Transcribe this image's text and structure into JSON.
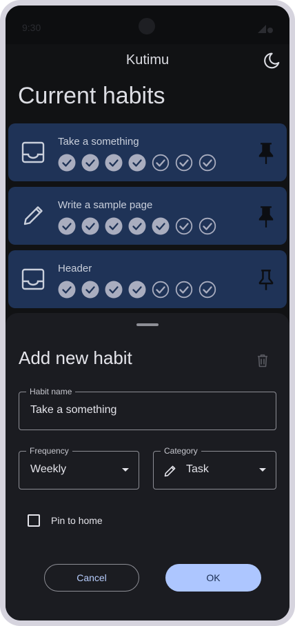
{
  "status_bar": {
    "time": "9:30"
  },
  "app_bar": {
    "title": "Kutimu",
    "theme_icon": "moon-icon"
  },
  "heading": "Current habits",
  "habits": [
    {
      "name": "Take a something",
      "icon": "inbox-tray-icon",
      "completed": [
        true,
        true,
        true,
        true,
        false,
        false,
        false
      ],
      "pinned": true
    },
    {
      "name": "Write a sample page",
      "icon": "pencil-icon",
      "completed": [
        true,
        true,
        true,
        true,
        true,
        false,
        false
      ],
      "pinned": true
    },
    {
      "name": "Header",
      "icon": "inbox-tray-icon",
      "completed": [
        true,
        true,
        true,
        true,
        false,
        false,
        false
      ],
      "pinned": false
    }
  ],
  "sheet": {
    "title": "Add new habit",
    "delete_icon": "trash-icon",
    "habit_name": {
      "label": "Habit name",
      "value": "Take a something"
    },
    "frequency": {
      "label": "Frequency",
      "value": "Weekly"
    },
    "category": {
      "label": "Category",
      "value": "Task",
      "icon": "pencil-icon"
    },
    "pin_to_home": {
      "label": "Pin to home",
      "checked": false
    },
    "cancel_label": "Cancel",
    "ok_label": "OK"
  },
  "colors": {
    "card": "#1f3357",
    "sheet": "#1b1c21",
    "accent": "#adc6ff",
    "check_filled": "#a9adbf"
  }
}
